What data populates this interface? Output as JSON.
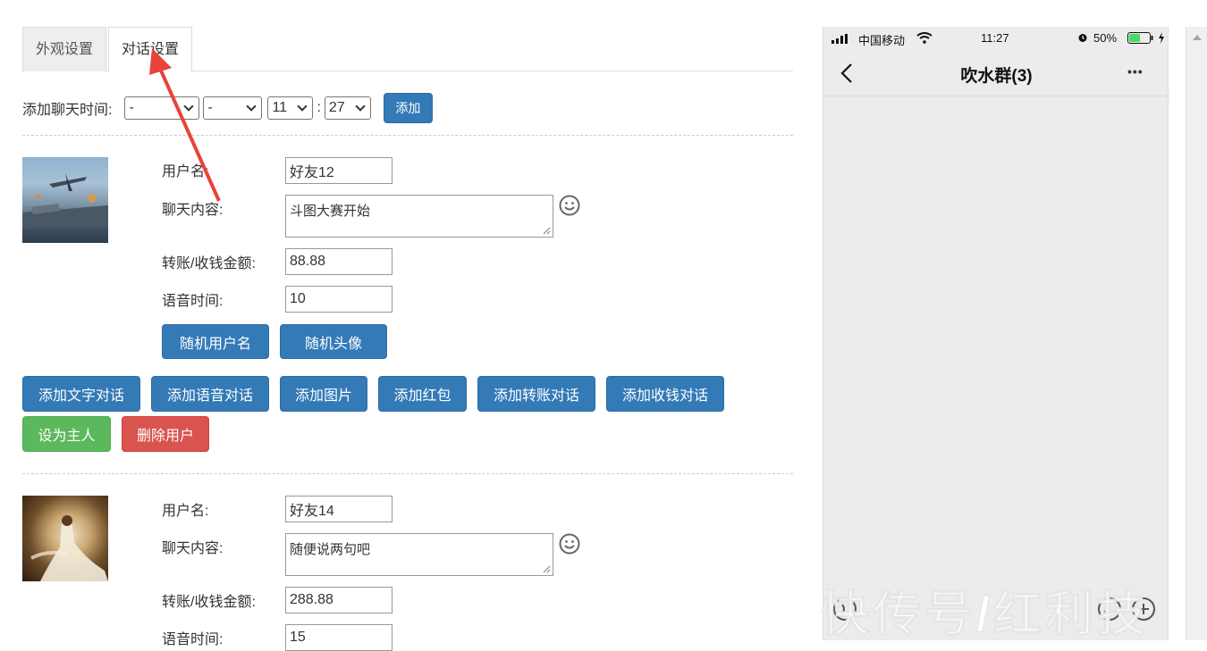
{
  "tabs": [
    {
      "label": "外观设置"
    },
    {
      "label": "对话设置"
    }
  ],
  "time_row": {
    "label": "添加聊天时间:",
    "selects": [
      "-",
      "-",
      "11",
      "27"
    ],
    "colon": ":",
    "add_button": "添加"
  },
  "users": [
    {
      "username_label": "用户名:",
      "username": "好友12",
      "content_label": "聊天内容:",
      "content": "斗图大赛开始",
      "amount_label": "转账/收钱金额:",
      "amount": "88.88",
      "voice_label": "语音时间:",
      "voice": "10",
      "random_name_button": "随机用户名",
      "random_avatar_button": "随机头像"
    },
    {
      "username_label": "用户名:",
      "username": "好友14",
      "content_label": "聊天内容:",
      "content": "随便说两句吧",
      "amount_label": "转账/收钱金额:",
      "amount": "288.88",
      "voice_label": "语音时间:",
      "voice": "15"
    }
  ],
  "actions": {
    "add_text": "添加文字对话",
    "add_voice": "添加语音对话",
    "add_image": "添加图片",
    "add_redpacket": "添加红包",
    "add_transfer": "添加转账对话",
    "add_receive": "添加收钱对话",
    "set_owner": "设为主人",
    "delete_user": "删除用户"
  },
  "phone": {
    "carrier": "中国移动",
    "time": "11:27",
    "battery": "50%",
    "title": "吹水群(3)",
    "more": "•••"
  },
  "watermark": "快传号/红利技",
  "colors": {
    "primary": "#337ab7",
    "success": "#5cb85c",
    "danger": "#d9534f",
    "annotation_arrow": "#e8443a",
    "battery": "#4cd964"
  }
}
